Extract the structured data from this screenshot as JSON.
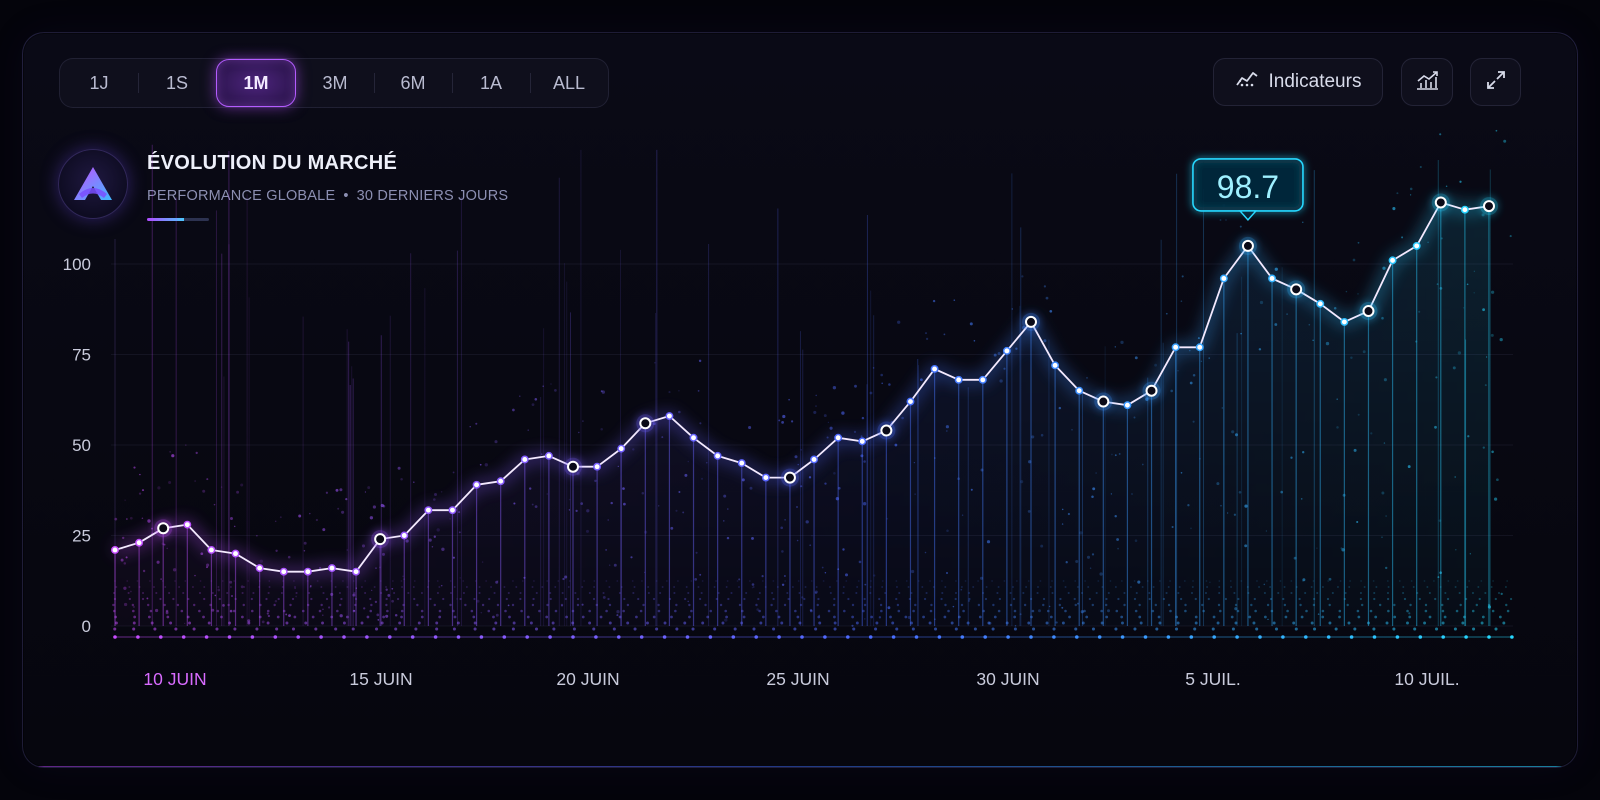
{
  "range_tabs": [
    {
      "label": "1J",
      "active": false
    },
    {
      "label": "1S",
      "active": false
    },
    {
      "label": "1M",
      "active": true
    },
    {
      "label": "3M",
      "active": false
    },
    {
      "label": "6M",
      "active": false
    },
    {
      "label": "1A",
      "active": false
    },
    {
      "label": "ALL",
      "active": false
    }
  ],
  "toolbar": {
    "indicators_label": "Indicateurs",
    "indicators_icon": "indicators-icon",
    "chart_type_icon": "line-chart-icon",
    "expand_icon": "expand-icon"
  },
  "header": {
    "title": "ÉVOLUTION DU MARCHÉ",
    "subtitle_left": "PERFORMANCE GLOBALE",
    "subtitle_sep": "•",
    "subtitle_right": "30 DERNIERS JOURS",
    "logo_icon": "triangle-logo-icon"
  },
  "colors": {
    "purple": "#c84dff",
    "blue": "#4a6bff",
    "cyan": "#27d8ff",
    "active_tab_border": "#b45cff",
    "background": "#04040b"
  },
  "chart_data": {
    "type": "line",
    "title": "ÉVOLUTION DU MARCHÉ",
    "xlabel": "",
    "ylabel": "",
    "ylim": [
      0,
      100
    ],
    "yticks": [
      "100",
      "75",
      "50",
      "25",
      "0"
    ],
    "ytick_values": [
      100,
      75,
      50,
      25,
      0
    ],
    "xtick_labels": [
      "10 JUIN",
      "15 JUIN",
      "20 JUIN",
      "25 JUIN",
      "30 JUIN",
      "5 JUIL.",
      "10 JUIL."
    ],
    "highlighted_xtick": "10 JUIN",
    "grid": true,
    "tooltip": {
      "label": "98.7"
    },
    "series": [
      {
        "values": [
          21,
          23,
          27,
          28,
          21,
          20,
          16,
          15,
          15,
          16,
          15,
          24,
          25,
          32,
          32,
          39,
          40,
          46,
          47,
          44,
          44,
          49,
          56,
          58,
          52,
          47,
          45,
          41,
          41,
          46,
          52,
          51,
          54,
          62,
          71,
          68,
          68,
          76,
          84,
          72,
          65,
          62,
          61,
          65,
          77,
          77,
          96,
          105,
          96,
          93,
          89,
          84,
          87,
          101,
          105,
          117,
          115,
          116
        ]
      }
    ]
  }
}
